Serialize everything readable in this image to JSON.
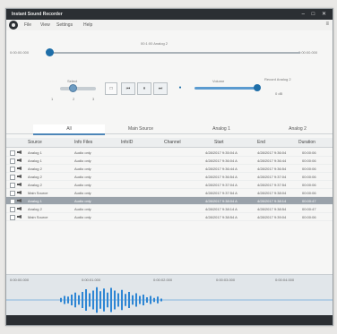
{
  "window": {
    "title": "Instant Sound Recorder",
    "controls": "–  □  ✕"
  },
  "menu": {
    "items": [
      "File",
      "View",
      "Settings",
      "Help"
    ],
    "right_icon": "≡"
  },
  "player": {
    "caption": "00:1:00 Analog 2",
    "elapsed": "0:00:00.000",
    "total": "0:00:00.000",
    "seek_fraction": 0.02,
    "buttons": [
      "□",
      "⏮",
      "⏸",
      "⏭",
      "●"
    ],
    "select_label": "Select",
    "select_values": [
      "1",
      "2",
      "3"
    ],
    "volume_label": "Volume",
    "volume_fraction": 1.0,
    "right_caption": "Record Analog 2",
    "right_sub": "0 dB"
  },
  "tabs": [
    "All",
    "Main Source",
    "Analog 1",
    "Analog 2"
  ],
  "table": {
    "columns": [
      "Source",
      "Info Files",
      "InfoID",
      "Channel",
      "Start",
      "End",
      "Duration"
    ],
    "rows": [
      {
        "source": "Analog 1",
        "info": "Audio only",
        "start": "4/28/2017 9:35:04 A",
        "end": "4/28/2017 9:36:04",
        "dur": "00:00:06",
        "selected": false
      },
      {
        "source": "Analog 1",
        "info": "Audio only",
        "start": "4/28/2017 9:36:04 A",
        "end": "4/28/2017 9:36:44",
        "dur": "00:00:06",
        "selected": false
      },
      {
        "source": "Analog 2",
        "info": "Audio only",
        "start": "4/28/2017 9:36:44 A",
        "end": "4/28/2017 9:36:54",
        "dur": "00:00:06",
        "selected": false
      },
      {
        "source": "Analog 2",
        "info": "Audio only",
        "start": "4/28/2017 9:36:54 A",
        "end": "4/28/2017 9:37:04",
        "dur": "00:00:06",
        "selected": false
      },
      {
        "source": "Analog 2",
        "info": "Audio only",
        "start": "4/28/2017 9:37:04 A",
        "end": "4/28/2017 9:37:54",
        "dur": "00:00:06",
        "selected": false
      },
      {
        "source": "Main Source",
        "info": "Audio only",
        "start": "4/28/2017 9:37:54 A",
        "end": "4/28/2017 9:38:04",
        "dur": "00:00:06",
        "selected": false
      },
      {
        "source": "Analog 1",
        "info": "Audio only",
        "start": "4/28/2017 9:38:04 A",
        "end": "4/28/2017 9:38:14",
        "dur": "00:00:47",
        "selected": true
      },
      {
        "source": "Analog 2",
        "info": "Audio only",
        "start": "4/28/2017 9:38:14 A",
        "end": "4/28/2017 9:38:54",
        "dur": "00:00:47",
        "selected": false
      },
      {
        "source": "Main Source",
        "info": "Audio only",
        "start": "4/28/2017 9:38:54 A",
        "end": "4/28/2017 9:39:04",
        "dur": "00:00:06",
        "selected": false
      }
    ]
  },
  "timeline": {
    "ticks": [
      "0:00:00.000",
      "0:00:01.000",
      "0:00:02.000",
      "0:00:03.000",
      "0:00:04.000"
    ]
  },
  "waveform": {
    "color": "#2e86d4",
    "amplitudes": [
      0.15,
      0.3,
      0.25,
      0.4,
      0.55,
      0.35,
      0.6,
      0.8,
      0.5,
      0.7,
      0.95,
      0.65,
      0.85,
      0.55,
      0.9,
      0.7,
      0.5,
      0.75,
      0.45,
      0.6,
      0.35,
      0.5,
      0.3,
      0.4,
      0.2,
      0.3,
      0.15,
      0.25,
      0.1
    ]
  },
  "colors": {
    "accent": "#1e6ea8",
    "titlebar": "#2b2f33",
    "selected_row": "#9aa2aa"
  }
}
